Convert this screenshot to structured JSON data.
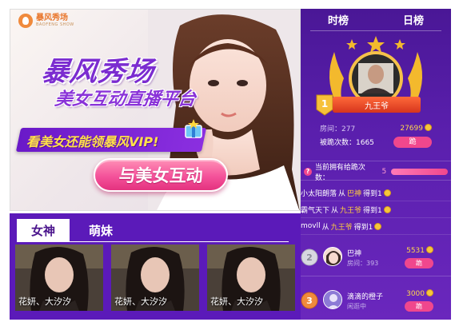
{
  "banner": {
    "brand_name": "暴风秀场",
    "brand_sub": "BAOFENG SHOW",
    "headline_main": "暴风秀场",
    "headline_sub": "美女互动直播平台",
    "promo": "看美女还能领暴风VIP!",
    "cta_label": "与美女互动"
  },
  "streamers": {
    "tabs": [
      {
        "label": "女神",
        "active": true
      },
      {
        "label": "萌妹",
        "active": false
      }
    ],
    "cards": [
      {
        "name": "花妍、大汐汐"
      },
      {
        "name": "花妍、大汐汐"
      },
      {
        "name": "花妍、大汐汐"
      }
    ]
  },
  "ranking": {
    "tabs": [
      {
        "label": "时榜",
        "active": true
      },
      {
        "label": "日榜",
        "active": false
      }
    ],
    "top": {
      "rank": "1",
      "name": "九王爷",
      "room_label": "房间：277",
      "points": "27699",
      "jumps_label": "被跪次数：1665",
      "button": "跪"
    },
    "owned": {
      "label": "当前拥有给跪次数：",
      "count": "5"
    },
    "feed": [
      {
        "a": "小太阳朗落",
        "mid": "从",
        "b": "巴神",
        "end": "得到1"
      },
      {
        "a": "霸气天下",
        "mid": "从",
        "b": "九王爷",
        "end": "得到1"
      },
      {
        "a": "movll",
        "mid": "从",
        "b": "九王爷",
        "end": "得到1"
      }
    ],
    "rows": [
      {
        "rank": "2",
        "name": "巴神",
        "sub": "房间：393",
        "points": "5531",
        "button": "跪"
      },
      {
        "rank": "3",
        "name": "滴滴的橙子",
        "sub": "闲逛中",
        "points": "3000",
        "button": "跪"
      }
    ]
  },
  "colors": {
    "panel_purple": "#5a1fad",
    "accent_pink": "#f0478d",
    "gold": "#ffcf3c"
  }
}
